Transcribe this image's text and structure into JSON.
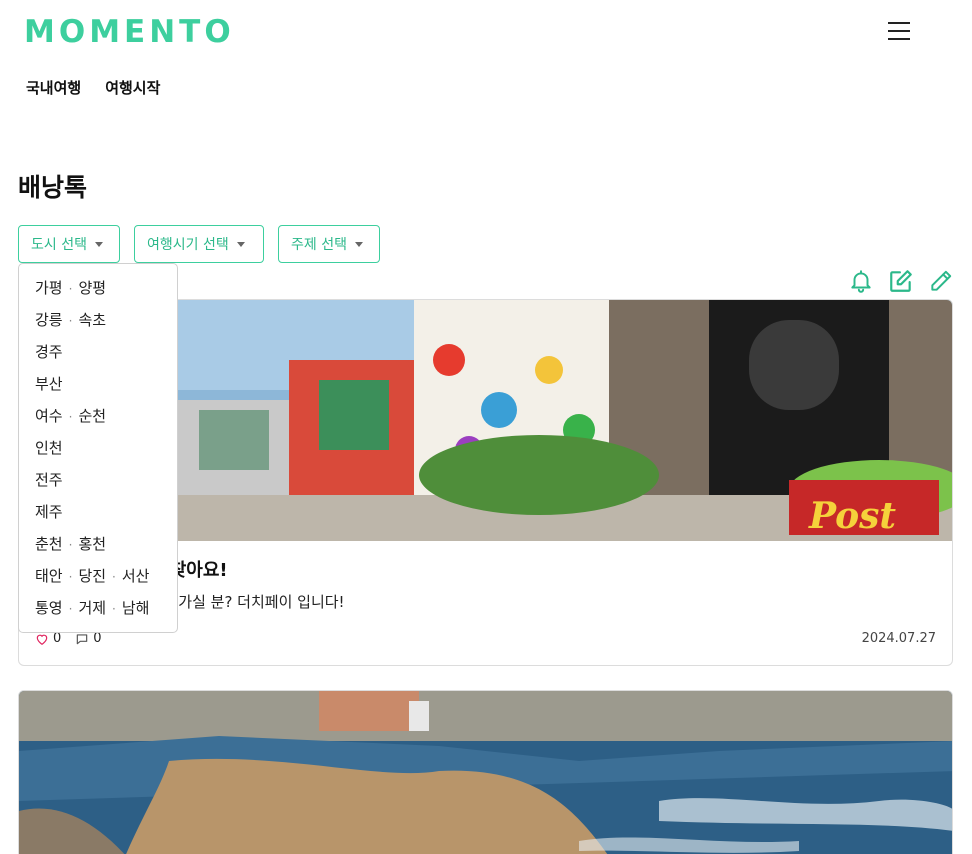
{
  "brand": {
    "logo": "MOMENTO",
    "accent": "#3dcf9e"
  },
  "nav": {
    "items": [
      "국내여행",
      "여행시작"
    ]
  },
  "page": {
    "title": "배낭톡"
  },
  "filters": {
    "city": "도시 선택",
    "season": "여행시기 선택",
    "theme": "주제 선택"
  },
  "city_dropdown": {
    "options": [
      [
        "가평",
        "양평"
      ],
      [
        "강릉",
        "속초"
      ],
      [
        "경주"
      ],
      [
        "부산"
      ],
      [
        "여수",
        "순천"
      ],
      [
        "인천"
      ],
      [
        "전주"
      ],
      [
        "제주"
      ],
      [
        "춘천",
        "홍천"
      ],
      [
        "태안",
        "당진",
        "서산"
      ],
      [
        "통영",
        "거제",
        "남해"
      ]
    ]
  },
  "icons": {
    "tools": [
      "bell-icon",
      "edit-note-icon",
      "pencil-icon"
    ]
  },
  "posts": [
    {
      "title_visible": "하 이용하시는 분 찾아요!",
      "desc_visible": "의 골목 가려해요 같이 가실 분? 더치페이 입니다!",
      "likes": "0",
      "comments": "0",
      "date": "2024.07.27"
    }
  ]
}
